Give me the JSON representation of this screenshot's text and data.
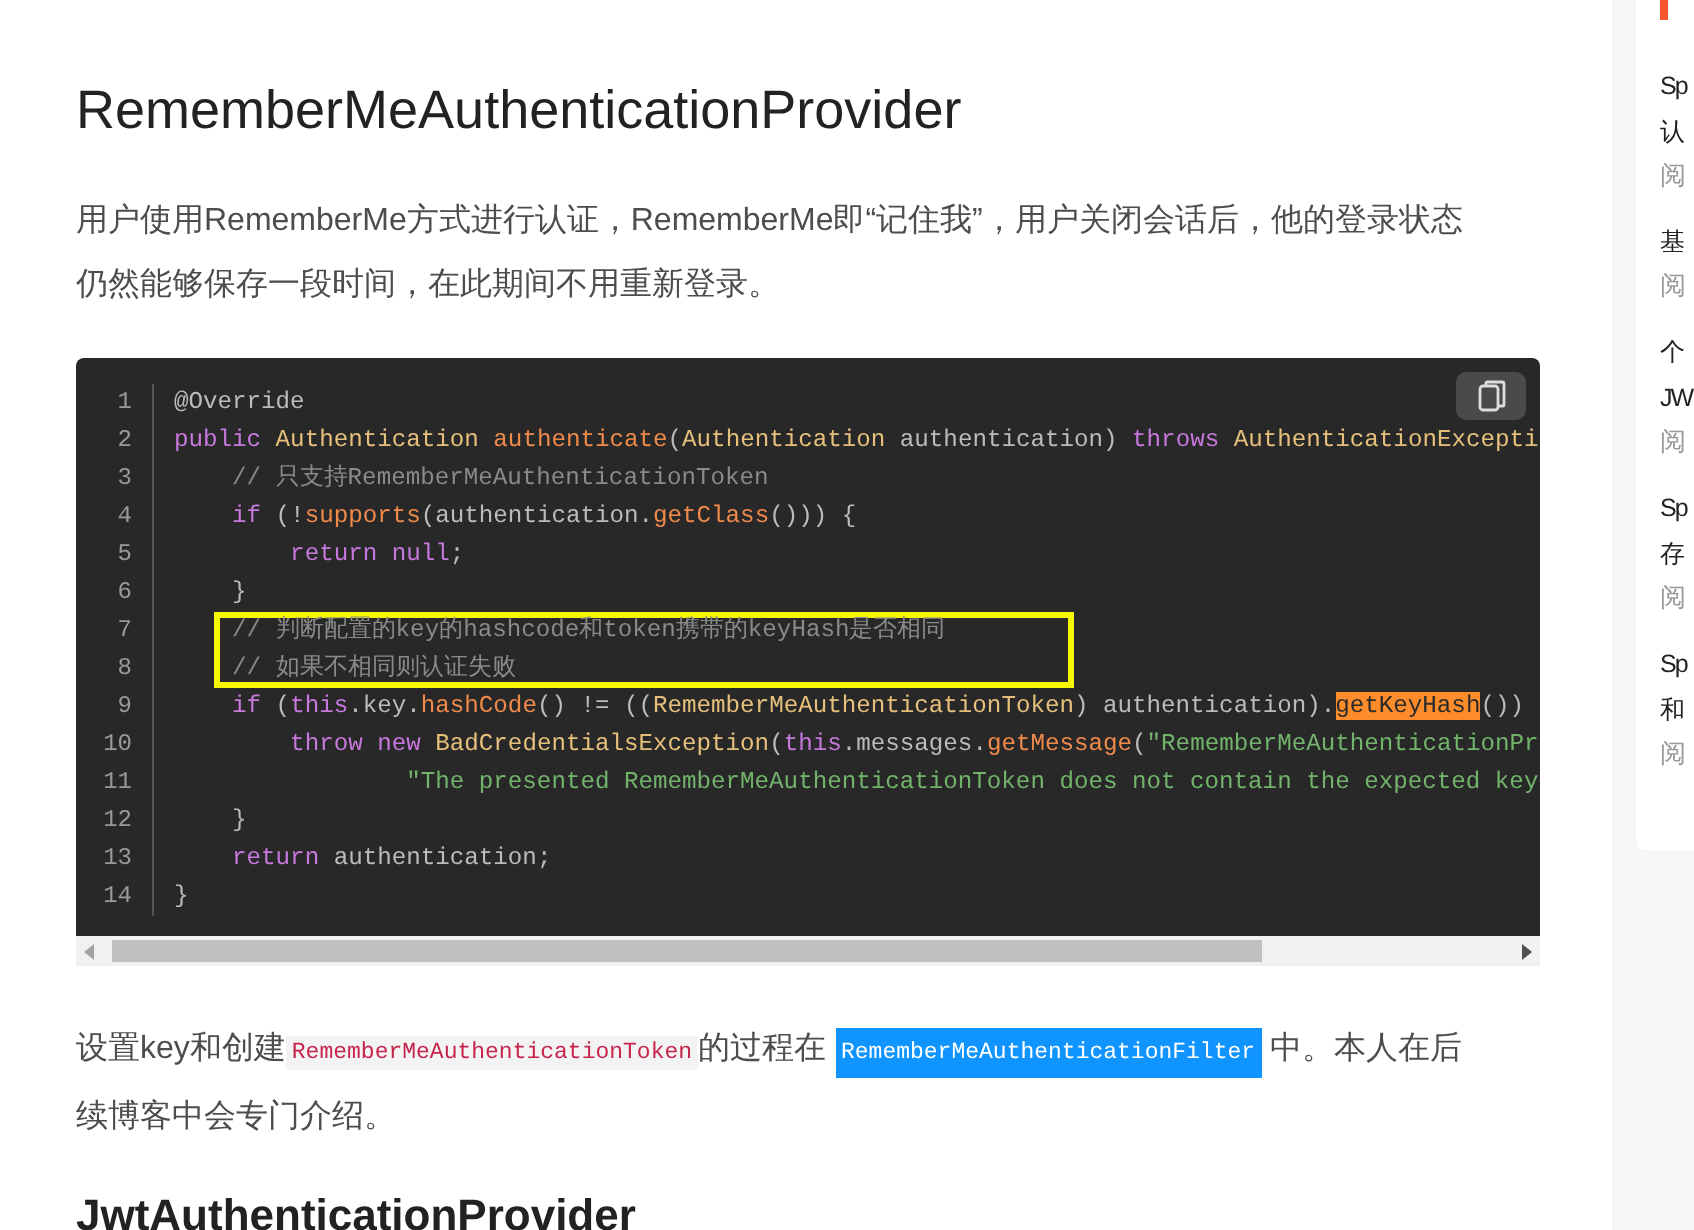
{
  "article": {
    "heading": "RememberMeAuthenticationProvider",
    "intro": "用户使用RememberMe方式进行认证，RememberMe即“记住我”，用户关闭会话后，他的登录状态仍然能够保存一段时间，在此期间不用重新登录。",
    "code_block": {
      "lines": [
        {
          "number": "1",
          "boxed": false,
          "tokens": [
            {
              "kind": "plain",
              "text": "@Override"
            }
          ]
        },
        {
          "number": "2",
          "boxed": false,
          "tokens": [
            {
              "kind": "keyword",
              "text": "public"
            },
            {
              "kind": "type",
              "text": " Authentication"
            },
            {
              "kind": "func",
              "text": " authenticate"
            },
            {
              "kind": "plain",
              "text": "("
            },
            {
              "kind": "type",
              "text": "Authentication"
            },
            {
              "kind": "plain",
              "text": " authentication) "
            },
            {
              "kind": "keyword",
              "text": "throws"
            },
            {
              "kind": "type",
              "text": " AuthenticationExcepti"
            }
          ]
        },
        {
          "number": "3",
          "boxed": false,
          "tokens": [
            {
              "kind": "comment",
              "text": "    // 只支持RememberMeAuthenticationToken"
            }
          ]
        },
        {
          "number": "4",
          "boxed": false,
          "tokens": [
            {
              "kind": "keyword",
              "text": "    if"
            },
            {
              "kind": "plain",
              "text": " (!"
            },
            {
              "kind": "func",
              "text": "supports"
            },
            {
              "kind": "plain",
              "text": "(authentication."
            },
            {
              "kind": "func",
              "text": "getClass"
            },
            {
              "kind": "plain",
              "text": "())) {"
            }
          ]
        },
        {
          "number": "5",
          "boxed": false,
          "tokens": [
            {
              "kind": "keyword",
              "text": "        return null"
            },
            {
              "kind": "plain",
              "text": ";"
            }
          ]
        },
        {
          "number": "6",
          "boxed": false,
          "tokens": [
            {
              "kind": "plain",
              "text": "    }"
            }
          ]
        },
        {
          "number": "7",
          "boxed": true,
          "tokens": [
            {
              "kind": "comment",
              "text": "    // 判断配置的key的hashcode和token携带的keyHash是否相同"
            }
          ]
        },
        {
          "number": "8",
          "boxed": true,
          "tokens": [
            {
              "kind": "comment",
              "text": "    // 如果不相同则认证失败"
            }
          ]
        },
        {
          "number": "9",
          "boxed": false,
          "tokens": [
            {
              "kind": "keyword",
              "text": "    if"
            },
            {
              "kind": "plain",
              "text": " ("
            },
            {
              "kind": "keyword",
              "text": "this"
            },
            {
              "kind": "plain",
              "text": ".key."
            },
            {
              "kind": "func",
              "text": "hashCode"
            },
            {
              "kind": "plain",
              "text": "() != (("
            },
            {
              "kind": "type",
              "text": "RememberMeAuthenticationToken"
            },
            {
              "kind": "plain",
              "text": ") authentication)."
            },
            {
              "kind": "match",
              "text": "getKeyHash"
            },
            {
              "kind": "plain",
              "text": "())"
            }
          ]
        },
        {
          "number": "10",
          "boxed": false,
          "tokens": [
            {
              "kind": "keyword",
              "text": "        throw new"
            },
            {
              "kind": "type",
              "text": " BadCredentialsException"
            },
            {
              "kind": "plain",
              "text": "("
            },
            {
              "kind": "keyword",
              "text": "this"
            },
            {
              "kind": "plain",
              "text": ".messages."
            },
            {
              "kind": "func",
              "text": "getMessage"
            },
            {
              "kind": "plain",
              "text": "("
            },
            {
              "kind": "string",
              "text": "\"RememberMeAuthenticationPr"
            }
          ]
        },
        {
          "number": "11",
          "boxed": false,
          "tokens": [
            {
              "kind": "string",
              "text": "                \"The presented RememberMeAuthenticationToken does not contain the expected key"
            }
          ]
        },
        {
          "number": "12",
          "boxed": false,
          "tokens": [
            {
              "kind": "plain",
              "text": "    }"
            }
          ]
        },
        {
          "number": "13",
          "boxed": false,
          "tokens": [
            {
              "kind": "keyword",
              "text": "    return"
            },
            {
              "kind": "plain",
              "text": " authentication;"
            }
          ]
        },
        {
          "number": "14",
          "boxed": false,
          "tokens": [
            {
              "kind": "plain",
              "text": "}"
            }
          ]
        }
      ]
    },
    "note": [
      {
        "kind": "text",
        "text": "设置key和创建"
      },
      {
        "kind": "code",
        "text": "RememberMeAuthenticationToken"
      },
      {
        "kind": "text",
        "text": "的过程在 "
      },
      {
        "kind": "selected-code",
        "text": "RememberMeAuthenticationFilter"
      },
      {
        "kind": "text",
        "text": " 中。本人在后续博客中会专门介绍。"
      }
    ],
    "next_heading": "JwtAuthenticationProvider"
  },
  "sidebar": {
    "items": [
      {
        "lines": [
          "Sp",
          "认"
        ],
        "meta": "阅"
      },
      {
        "lines": [
          "基"
        ],
        "meta": "阅"
      },
      {
        "lines": [
          "个",
          "JW"
        ],
        "meta": "阅"
      },
      {
        "lines": [
          "Sp",
          "存"
        ],
        "meta": "阅"
      },
      {
        "lines": [
          "Sp",
          "和"
        ],
        "meta": "阅"
      }
    ]
  }
}
